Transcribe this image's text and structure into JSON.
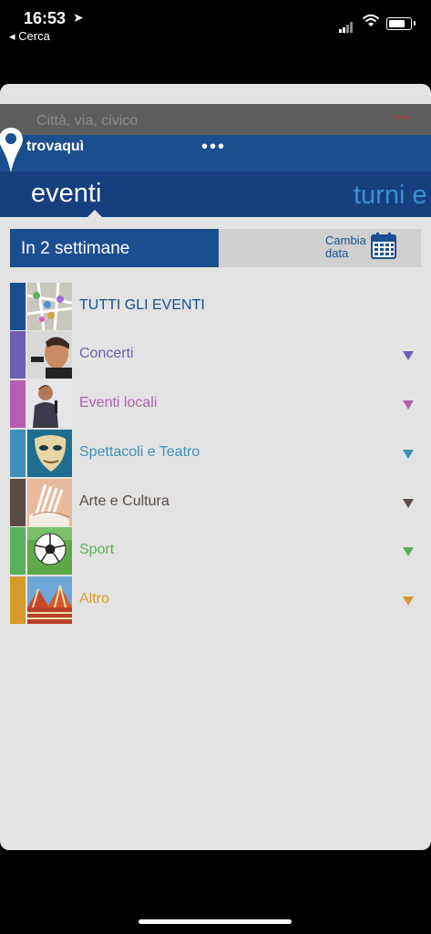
{
  "status_bar": {
    "time": "16:53",
    "back_label": "◂ Cerca"
  },
  "search": {
    "placeholder": "Città, via, civico"
  },
  "header": {
    "logo_text": "trovaquì",
    "menu_dots": "•••"
  },
  "tabs": [
    {
      "label": "eventi",
      "selected": true
    },
    {
      "label": "turni e"
    }
  ],
  "date_filter": {
    "label": "In 2 settimane",
    "change_label_line1": "Cambia",
    "change_label_line2": "data"
  },
  "categories": [
    {
      "label": "TUTTI GLI EVENTI",
      "color": "#1b4e8f",
      "icon": "map-pins-icon"
    },
    {
      "label": "Concerti",
      "color": "#6e5fb3",
      "icon": "singer-icon"
    },
    {
      "label": "Eventi locali",
      "color": "#b45fb3",
      "icon": "speaker-icon"
    },
    {
      "label": "Spettacoli e Teatro",
      "color": "#3f8fb8",
      "icon": "theatre-mask-icon"
    },
    {
      "label": "Arte e Cultura",
      "color": "#5a4a44",
      "icon": "book-icon"
    },
    {
      "label": "Sport",
      "color": "#5aaf5a",
      "icon": "soccer-ball-icon"
    },
    {
      "label": "Altro",
      "color": "#d49a2c",
      "icon": "tent-icon"
    }
  ]
}
